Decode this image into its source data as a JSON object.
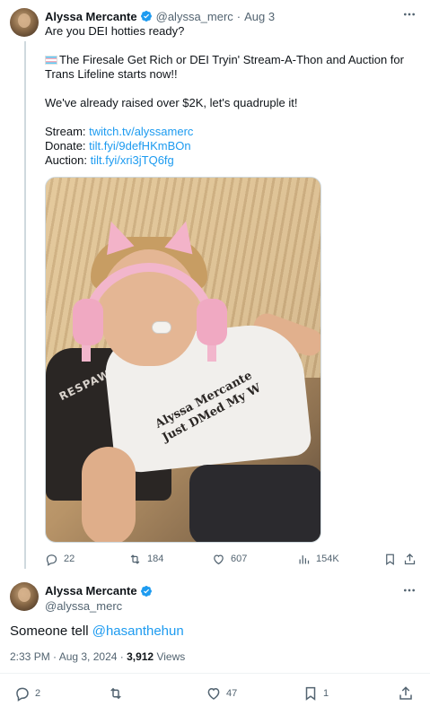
{
  "tweet1": {
    "display_name": "Alyssa Mercante",
    "handle": "@alyssa_merc",
    "separator": "·",
    "date": "Aug 3",
    "line1": "Are you DEI hotties ready?",
    "line2": "The Firesale Get Rich or DEI Tryin' Stream-A-Thon and Auction for Trans Lifeline starts now!!",
    "line3": "We've already raised over $2K, let's quadruple it!",
    "stream_label": "Stream: ",
    "stream_link": "twitch.tv/alyssamerc",
    "donate_label": "Donate: ",
    "donate_link": "tilt.fyi/9defHKmBOn",
    "auction_label": "Auction: ",
    "auction_link": "tilt.fyi/xri3jTQ6fg",
    "photo": {
      "chair_brand": "RESPAWN",
      "shirt_line1": "Alyssa Mercante",
      "shirt_line2": "Just DMed My W"
    },
    "replies": "22",
    "reposts": "184",
    "likes": "607",
    "views": "154K"
  },
  "tweet2": {
    "display_name": "Alyssa Mercante",
    "handle": "@alyssa_merc",
    "text_prefix": "Someone tell ",
    "mention": "@hasanthehun",
    "time": "2:33 PM · Aug 3, 2024 · ",
    "views_count": "3,912",
    "views_label": " Views",
    "replies": "2",
    "likes": "47",
    "bookmarks": "1"
  },
  "colors": {
    "link": "#1d9bf0",
    "verified": "#1d9bf0",
    "muted": "#536471",
    "text": "#0f1419"
  }
}
